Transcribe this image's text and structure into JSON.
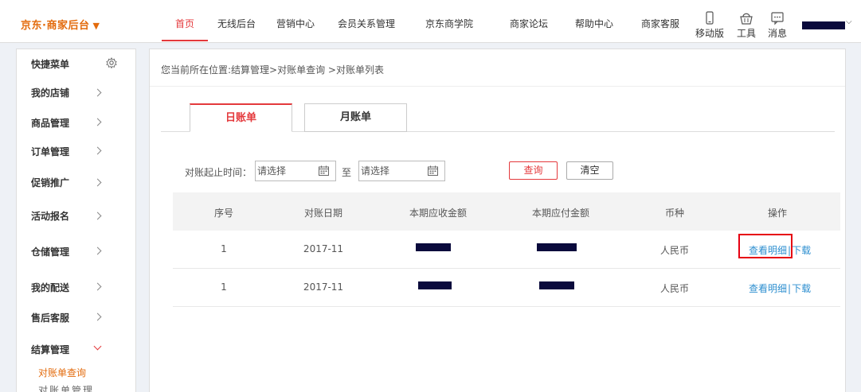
{
  "header": {
    "brand": "京东·商家后台",
    "brand_caret": "▼",
    "nav": [
      "首页",
      "无线后台",
      "营销中心",
      "会员关系管理",
      "京东商学院",
      "商家论坛",
      "帮助中心",
      "商家客服"
    ],
    "tools": [
      {
        "icon": "mobile-icon",
        "label": "移动版"
      },
      {
        "icon": "basket-icon",
        "label": "工具"
      },
      {
        "icon": "chat-icon",
        "label": "消息"
      }
    ],
    "user_caret": "⌵"
  },
  "sidebar": {
    "items": [
      {
        "label": "快捷菜单"
      },
      {
        "label": "我的店铺"
      },
      {
        "label": "商品管理"
      },
      {
        "label": "订单管理"
      },
      {
        "label": "促销推广"
      },
      {
        "label": "活动报名"
      },
      {
        "label": "仓储管理"
      },
      {
        "label": "我的配送"
      },
      {
        "label": "售后客服"
      },
      {
        "label": "结算管理"
      }
    ],
    "sub_active": "对账单查询",
    "sub_next": "对账单管理"
  },
  "breadcrumb": "您当前所在位置:结算管理>对账单查询 >对账单列表",
  "tabs": [
    "日账单",
    "月账单"
  ],
  "filter": {
    "label": "对账起止时间：",
    "start_placeholder": "请选择",
    "to": "至",
    "end_placeholder": "请选择",
    "query": "查询",
    "clear": "清空"
  },
  "table": {
    "headers": [
      "序号",
      "对账日期",
      "本期应收金额",
      "本期应付金额",
      "币种",
      "操作"
    ],
    "rows": [
      {
        "index": "1",
        "date": "2017-11",
        "receivable": "",
        "payable": "",
        "currency": "人民币",
        "detail": "查看明细",
        "sep": "|",
        "download": "下载"
      },
      {
        "index": "1",
        "date": "2017-11",
        "receivable": "",
        "payable": "",
        "currency": "人民币",
        "detail": "查看明细",
        "sep": "|",
        "download": "下载"
      }
    ]
  },
  "colors": {
    "accent": "#e4393c",
    "brand": "#e36b0d",
    "link": "#2e8fd0",
    "highlight": "#e60012"
  }
}
